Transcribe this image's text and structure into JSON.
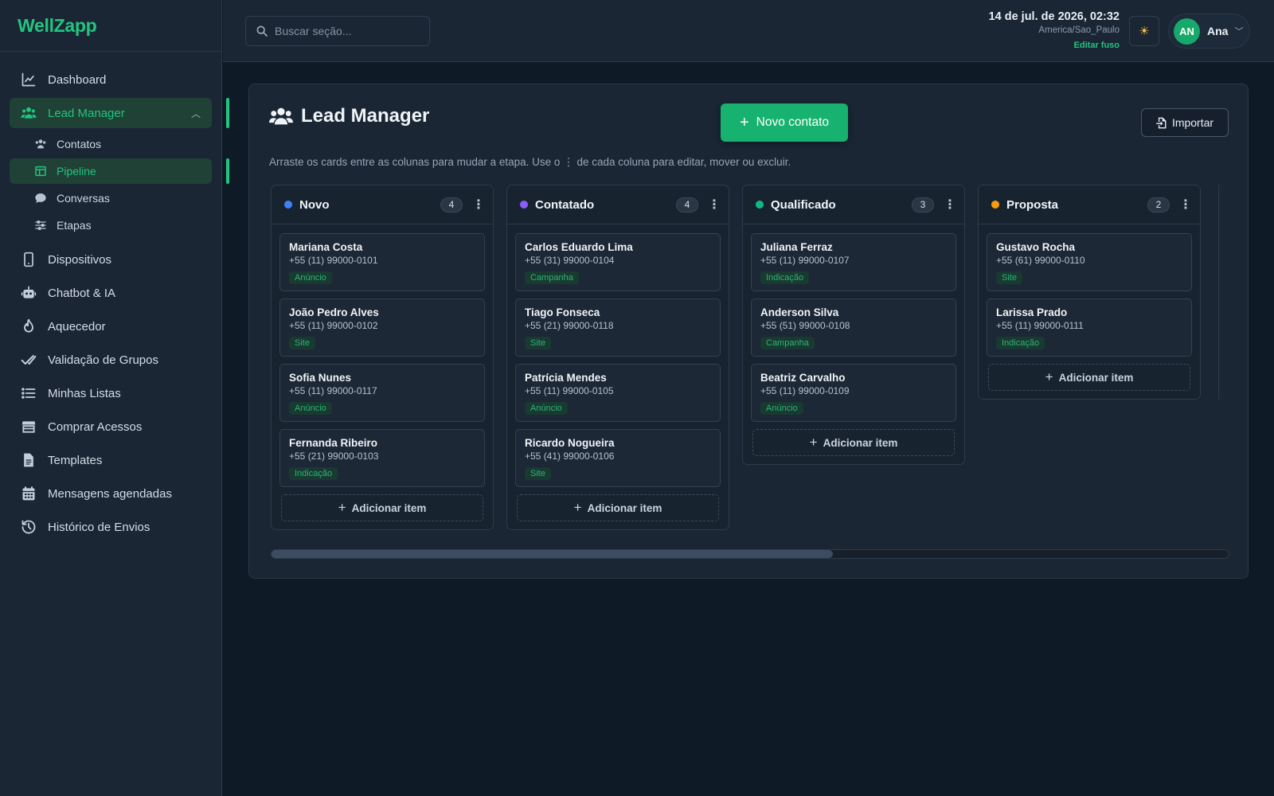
{
  "brand": "WellZapp",
  "sidebar": {
    "items": [
      {
        "label": "Dashboard",
        "icon": "chart-line-icon"
      },
      {
        "label": "Lead Manager",
        "icon": "users-icon",
        "active": true
      },
      {
        "label": "Dispositivos",
        "icon": "mobile-icon"
      },
      {
        "label": "Chatbot & IA",
        "icon": "robot-icon"
      },
      {
        "label": "Aquecedor",
        "icon": "flame-icon"
      },
      {
        "label": "Validação de Grupos",
        "icon": "double-check-icon"
      },
      {
        "label": "Minhas Listas",
        "icon": "list-icon"
      },
      {
        "label": "Comprar Acessos",
        "icon": "store-icon"
      },
      {
        "label": "Templates",
        "icon": "document-icon"
      },
      {
        "label": "Mensagens agendadas",
        "icon": "calendar-icon"
      },
      {
        "label": "Histórico de Envios",
        "icon": "history-icon"
      }
    ],
    "sub_items": [
      {
        "label": "Contatos",
        "icon": "users-small-icon"
      },
      {
        "label": "Pipeline",
        "icon": "table-columns-icon",
        "active": true
      },
      {
        "label": "Conversas",
        "icon": "chat-bubble-icon"
      },
      {
        "label": "Etapas",
        "icon": "sliders-icon"
      }
    ]
  },
  "topbar": {
    "search_placeholder": "Buscar seção...",
    "datetime": "14 de jul. de 2026, 02:32",
    "timezone": "America/Sao_Paulo",
    "edit_tz": "Editar fuso",
    "theme_icon": "sun-icon",
    "user": {
      "initials": "AN",
      "name": "Ana"
    }
  },
  "main": {
    "title": "Lead Manager",
    "new_contact": "Novo contato",
    "import": "Importar",
    "hint": "Arraste os cards entre as colunas para mudar a etapa. Use o ⋮ de cada coluna para editar, mover ou excluir.",
    "add_item": "Adicionar item",
    "columns": [
      {
        "title": "Novo",
        "count": "4",
        "color": "#3b82f6",
        "cards": [
          {
            "name": "Mariana Costa",
            "phone": "+55 (11) 99000-0101",
            "tag": "Anúncio"
          },
          {
            "name": "João Pedro Alves",
            "phone": "+55 (11) 99000-0102",
            "tag": "Site"
          },
          {
            "name": "Sofia Nunes",
            "phone": "+55 (11) 99000-0117",
            "tag": "Anúncio"
          },
          {
            "name": "Fernanda Ribeiro",
            "phone": "+55 (21) 99000-0103",
            "tag": "Indicação"
          }
        ]
      },
      {
        "title": "Contatado",
        "count": "4",
        "color": "#8b5cf6",
        "cards": [
          {
            "name": "Carlos Eduardo Lima",
            "phone": "+55 (31) 99000-0104",
            "tag": "Campanha"
          },
          {
            "name": "Tiago Fonseca",
            "phone": "+55 (21) 99000-0118",
            "tag": "Site"
          },
          {
            "name": "Patrícia Mendes",
            "phone": "+55 (11) 99000-0105",
            "tag": "Anúncio"
          },
          {
            "name": "Ricardo Nogueira",
            "phone": "+55 (41) 99000-0106",
            "tag": "Site"
          }
        ]
      },
      {
        "title": "Qualificado",
        "count": "3",
        "color": "#10b981",
        "cards": [
          {
            "name": "Juliana Ferraz",
            "phone": "+55 (11) 99000-0107",
            "tag": "Indicação"
          },
          {
            "name": "Anderson Silva",
            "phone": "+55 (51) 99000-0108",
            "tag": "Campanha"
          },
          {
            "name": "Beatriz Carvalho",
            "phone": "+55 (11) 99000-0109",
            "tag": "Anúncio"
          }
        ]
      },
      {
        "title": "Proposta",
        "count": "2",
        "color": "#f59e0b",
        "cards": [
          {
            "name": "Gustavo Rocha",
            "phone": "+55 (61) 99000-0110",
            "tag": "Site"
          },
          {
            "name": "Larissa Prado",
            "phone": "+55 (11) 99000-0111",
            "tag": "Indicação"
          }
        ]
      }
    ]
  },
  "colors": {
    "accent": "#22c57f",
    "background": "#0f1a27",
    "surface": "#1a2634"
  }
}
